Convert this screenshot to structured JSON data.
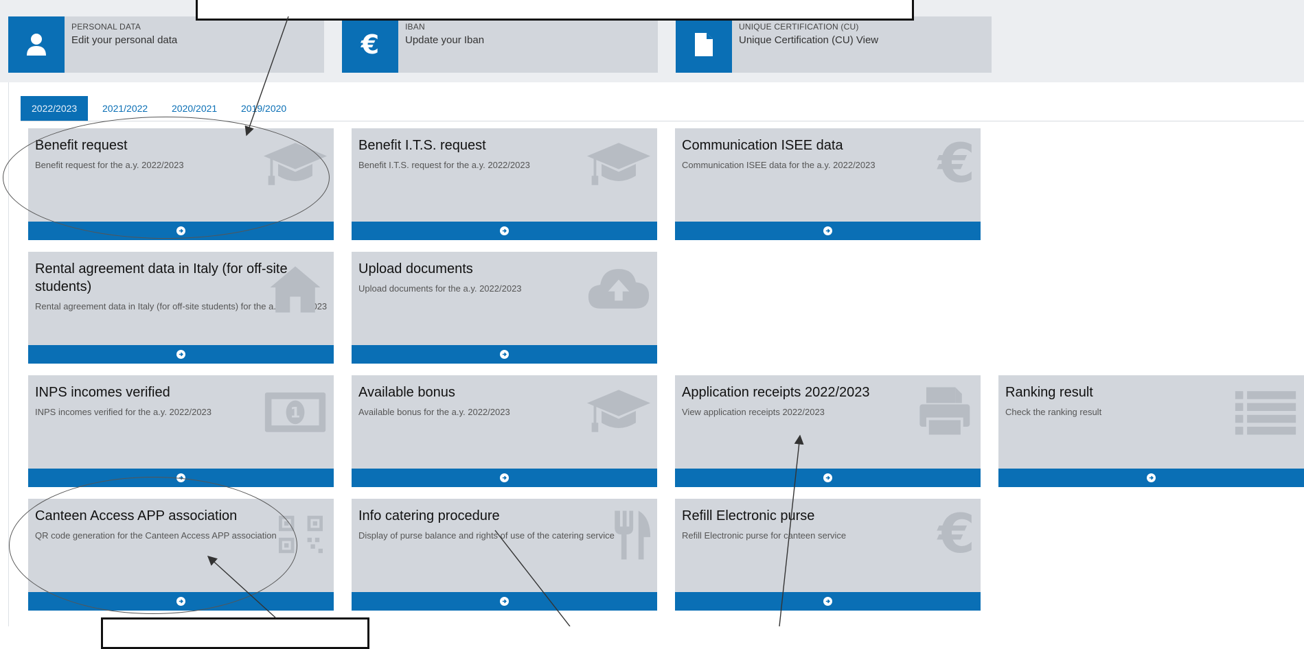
{
  "quick_links": [
    {
      "key": "PERSONAL DATA",
      "value": "Edit your personal data",
      "icon": "user-icon"
    },
    {
      "key": "IBAN",
      "value": "Update your Iban",
      "icon": "euro-icon"
    },
    {
      "key": "UNIQUE CERTIFICATION (CU)",
      "value": "Unique Certification (CU) View",
      "icon": "document-icon"
    }
  ],
  "year_tabs": [
    "2022/2023",
    "2021/2022",
    "2020/2021",
    "2019/2020"
  ],
  "active_tab": "2022/2023",
  "cards": [
    {
      "title": "Benefit request",
      "desc": "Benefit request for the a.y. 2022/2023",
      "icon": "graduation-cap-icon"
    },
    {
      "title": "Benefit I.T.S. request",
      "desc": "Benefit I.T.S. request for the a.y. 2022/2023",
      "icon": "graduation-cap-icon"
    },
    {
      "title": "Communication ISEE data",
      "desc": "Communication ISEE data for the a.y. 2022/2023",
      "icon": "euro-icon"
    },
    {
      "title": "Rental agreement data in Italy (for off-site students)",
      "desc": "Rental agreement data in Italy (for off-site students) for the a.y. 2022/2023",
      "icon": "house-icon"
    },
    {
      "title": "Upload documents",
      "desc": "Upload documents for the a.y. 2022/2023",
      "icon": "cloud-upload-icon"
    },
    {
      "title": "INPS incomes verified",
      "desc": "INPS incomes verified for the a.y. 2022/2023",
      "icon": "banknote-icon"
    },
    {
      "title": "Available bonus",
      "desc": "Available bonus for the a.y. 2022/2023",
      "icon": "graduation-cap-icon"
    },
    {
      "title": "Application receipts 2022/2023",
      "desc": "View application receipts 2022/2023",
      "icon": "printer-icon"
    },
    {
      "title": "Ranking result",
      "desc": "Check the ranking result",
      "icon": "list-icon"
    },
    {
      "title": "Canteen Access APP association",
      "desc": "QR code generation for the Canteen Access APP association",
      "icon": "qr-code-icon"
    },
    {
      "title": "Info catering procedure",
      "desc": "Display of purse balance and rights of use of the catering service",
      "icon": "fork-knife-icon"
    },
    {
      "title": "Refill Electronic purse",
      "desc": "Refill Electronic purse for canteen service",
      "icon": "euro-icon"
    }
  ],
  "colors": {
    "accent": "#0a6fb5",
    "card_bg": "#d2d6dc",
    "band_bg": "#eceef1",
    "icon_fill": "#b7bcc3"
  }
}
